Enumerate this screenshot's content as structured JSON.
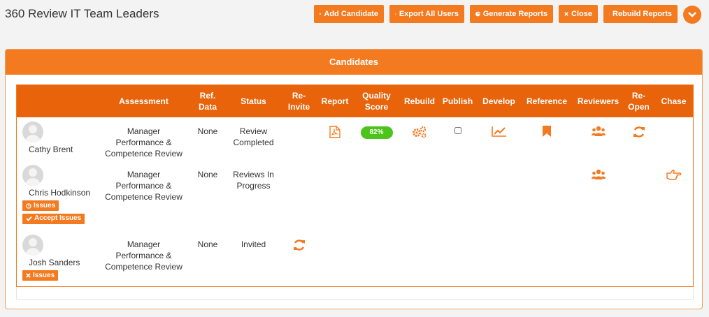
{
  "page": {
    "title": "360 Review IT Team Leaders"
  },
  "toolbar": {
    "add_candidate": "Add Candidate",
    "export_all_users": "Export All Users",
    "generate_reports": "Generate Reports",
    "close": "Close",
    "rebuild_reports": "Rebuild Reports"
  },
  "panel": {
    "title": "Candidates"
  },
  "table": {
    "columns": {
      "assessment": "Assessment",
      "ref_data_1": "Ref.",
      "ref_data_2": "Data",
      "status": "Status",
      "reinvite_1": "Re-",
      "reinvite_2": "Invite",
      "report": "Report",
      "quality_1": "Quality",
      "quality_2": "Score",
      "rebuild": "Rebuild",
      "publish": "Publish",
      "develop": "Develop",
      "reference": "Reference",
      "reviewers": "Reviewers",
      "reopen_1": "Re-",
      "reopen_2": "Open",
      "chase": "Chase"
    },
    "rows": [
      {
        "name": "Cathy Brent",
        "assessment_1": "Manager",
        "assessment_2": "Performance &",
        "assessment_3": "Competence Review",
        "ref_data": "None",
        "status_1": "Review",
        "status_2": "Completed",
        "quality_score": "82%"
      },
      {
        "name": "Chris Hodkinson",
        "assessment_1": "Manager",
        "assessment_2": "Performance &",
        "assessment_3": "Competence Review",
        "ref_data": "None",
        "status_1": "Reviews In",
        "status_2": "Progress",
        "tag_issues": "Issues",
        "tag_accept": "Accept Issues"
      },
      {
        "name": "Josh Sanders",
        "assessment_1": "Manager",
        "assessment_2": "Performance &",
        "assessment_3": "Competence Review",
        "ref_data": "None",
        "status_1": "Invited",
        "tag_issues": "Issues"
      }
    ]
  },
  "colors": {
    "accent": "#f47a20",
    "header": "#e8630a",
    "quality": "#4cc41c"
  }
}
